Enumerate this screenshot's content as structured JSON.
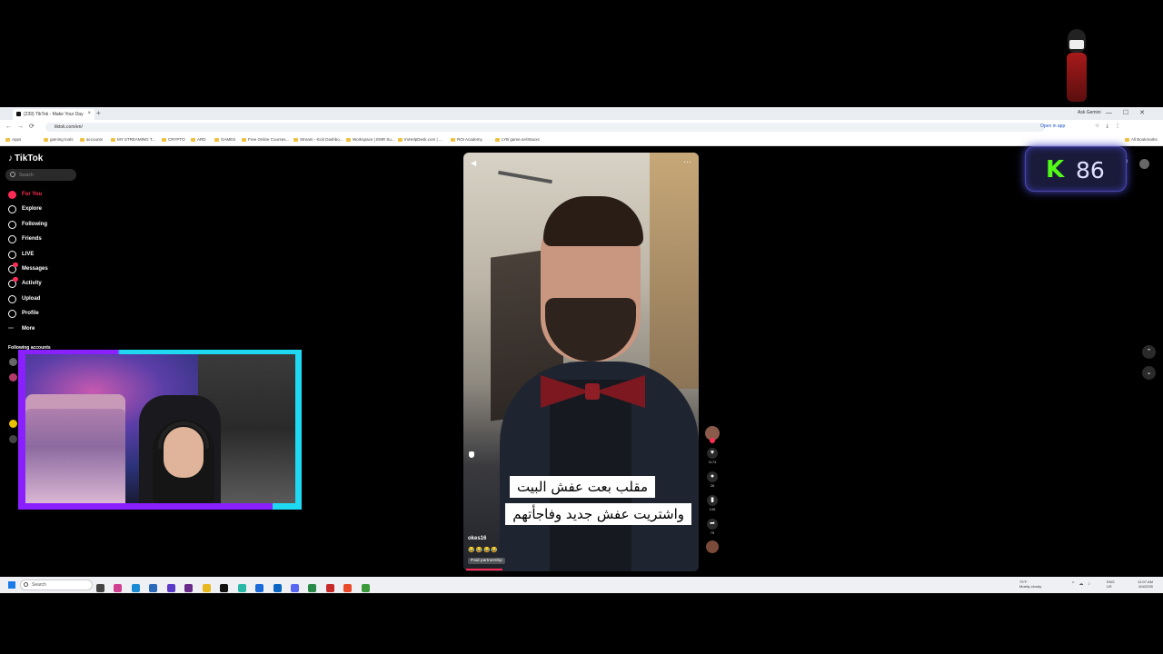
{
  "browser": {
    "tab_title": "(239) TikTok - Make Your Day",
    "new_tab": "+",
    "url": "tiktok.com/en/",
    "open_in_app": "Open in app",
    "ask_gemini": "Ask Gemini",
    "bookmarks": [
      "Apps",
      "gaming tools",
      "accounts",
      "MY STREAMING T...",
      "CRYPTO",
      "ARD",
      "GAMES",
      "Free Online Courses...",
      "Stream - Kick Dashbo...",
      "Workspace | EMR Su...",
      "ImHelpDesk.com | ...",
      "ROI Academy",
      "LYB game.ne/Staxxs"
    ],
    "all_bookmarks": "All Bookmarks"
  },
  "tiktok": {
    "logo": "TikTok",
    "search_placeholder": "Search",
    "nav": [
      {
        "label": "For You",
        "icon": "home-icon",
        "active": true
      },
      {
        "label": "Explore",
        "icon": "compass-icon"
      },
      {
        "label": "Following",
        "icon": "following-icon"
      },
      {
        "label": "Friends",
        "icon": "friends-icon"
      },
      {
        "label": "LIVE",
        "icon": "live-icon"
      },
      {
        "label": "Messages",
        "icon": "messages-icon"
      },
      {
        "label": "Activity",
        "icon": "activity-icon"
      },
      {
        "label": "Upload",
        "icon": "upload-icon"
      },
      {
        "label": "Profile",
        "icon": "profile-icon"
      },
      {
        "label": "More",
        "icon": "more-icon"
      }
    ],
    "following_accounts_title": "Following accounts",
    "login_fragment": "p"
  },
  "video": {
    "caption_line1": "مقلب بعت عفش البيت",
    "caption_line2": "واشتريت عفش جديد وفاجأتهم",
    "author": "okes16",
    "desc": "😂😂😂😂",
    "paid_label": "Paid partnership",
    "likes": "1174",
    "comments": "26",
    "saves": "106",
    "shares": "75"
  },
  "kick": {
    "logo": "K",
    "count": "86"
  },
  "taskbar": {
    "search": "Search",
    "weather_temp": "79°F",
    "weather_desc": "Mostly cloudy",
    "lang": "ENG",
    "region": "US",
    "time": "12:07 AM",
    "date": "8/4/2025"
  },
  "colors": {
    "tiktok_red": "#fe2c55",
    "kick_green": "#53fc18",
    "cam_purple": "#8a20ff",
    "cam_cyan": "#1fd8f2"
  }
}
